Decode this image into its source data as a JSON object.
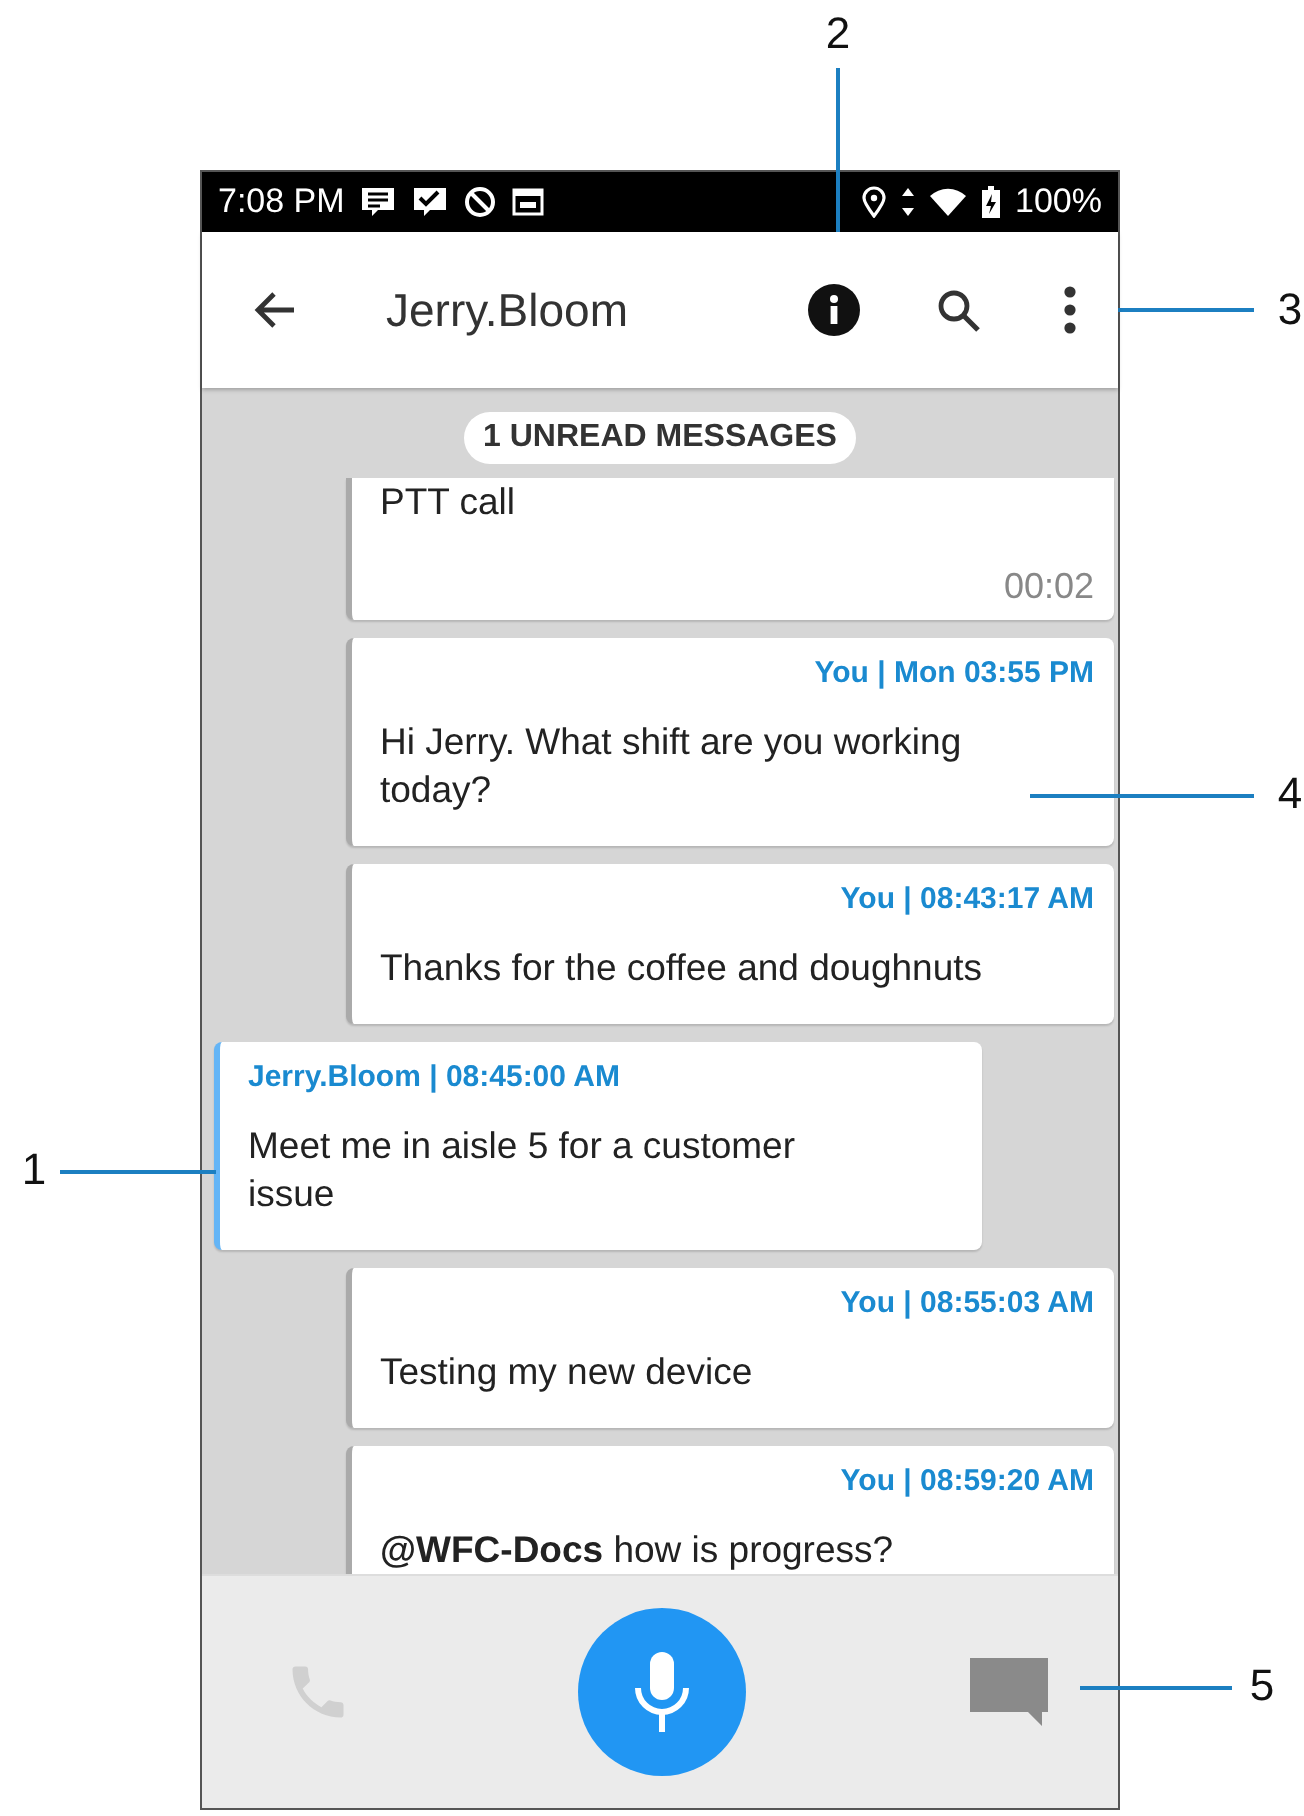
{
  "status_bar": {
    "time": "7:08 PM",
    "battery": "100%"
  },
  "app_bar": {
    "title": "Jerry.Bloom"
  },
  "unread_badge": "1 UNREAD MESSAGES",
  "messages": [
    {
      "kind": "call",
      "outgoing": true,
      "text": "PTT call",
      "duration": "00:02"
    },
    {
      "kind": "text",
      "outgoing": true,
      "header": "You | Mon 03:55 PM",
      "text": "Hi Jerry. What shift are you working today?"
    },
    {
      "kind": "text",
      "outgoing": true,
      "header": "You | 08:43:17 AM",
      "text": "Thanks for the coffee and doughnuts"
    },
    {
      "kind": "text",
      "outgoing": false,
      "header": "Jerry.Bloom | 08:45:00 AM",
      "text": "Meet me in aisle 5 for a customer issue"
    },
    {
      "kind": "text",
      "outgoing": true,
      "header": "You | 08:55:03 AM",
      "text": "Testing my new device"
    },
    {
      "kind": "text",
      "outgoing": true,
      "header": "You | 08:59:20 AM",
      "text": "**@WFC-Docs** how is progress?"
    }
  ],
  "call_button": {
    "disabled": true
  },
  "callouts": [
    {
      "label": "1"
    },
    {
      "label": "2"
    },
    {
      "label": "3"
    },
    {
      "label": "4"
    },
    {
      "label": "5"
    }
  ]
}
